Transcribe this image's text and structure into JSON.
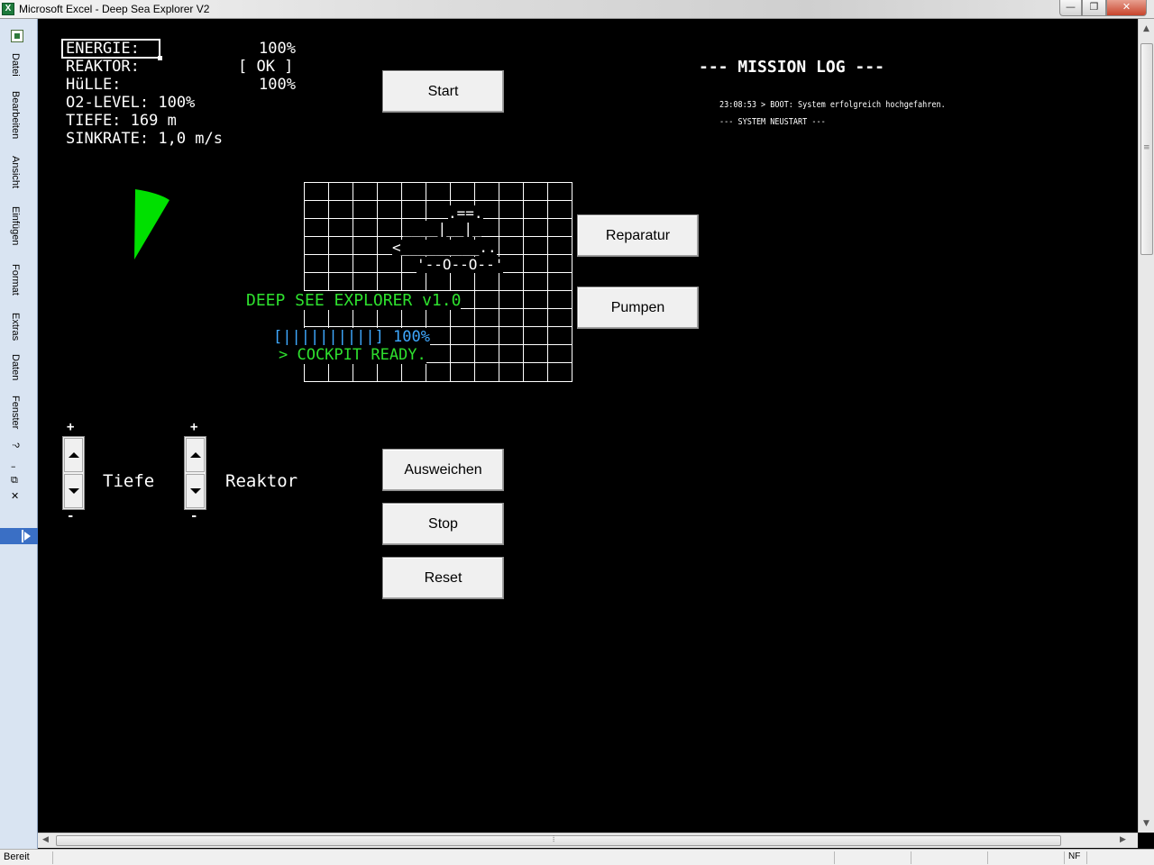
{
  "window": {
    "title": "Microsoft Excel - Deep Sea Explorer V2",
    "app_icon": "X",
    "minimize": "—",
    "maximize": "❐",
    "close": "✕"
  },
  "menu": {
    "items": [
      "Datei",
      "Bearbeiten",
      "Ansicht",
      "Einfügen",
      "Format",
      "Extras",
      "Daten",
      "Fenster",
      "?"
    ],
    "doc_min": "–",
    "doc_restore": "⧉",
    "doc_close": "✕"
  },
  "status": {
    "text": "Bereit",
    "nf": "NF"
  },
  "stats": {
    "energie_label": "ENERGIE:",
    "energie_value": "100%",
    "reaktor_label": "REAKTOR:",
    "reaktor_value": "[ OK ]",
    "huelle_label": "HüLLE:",
    "huelle_value": "100%",
    "o2": "O2-LEVEL: 100%",
    "tiefe": "TIEFE: 169 m",
    "sinkrate": "SINKRATE: 1,0 m/s"
  },
  "buttons": {
    "start": "Start",
    "reparatur": "Reparatur",
    "pumpen": "Pumpen",
    "ausweichen": "Ausweichen",
    "stop": "Stop",
    "reset": "Reset"
  },
  "log": {
    "title": "--- MISSION LOG ---",
    "lines": [
      "23:08:53 > BOOT: System erfolgreich hochgefahren.",
      "--- SYSTEM NEUSTART ---"
    ]
  },
  "ascii_sub": {
    "line1": ".==.",
    "line2": "____|__|_",
    "line3": "<_________..",
    "line4": "'--O--O--'"
  },
  "screen": {
    "title": "DEEP SEE EXPLORER v1.0",
    "progress": "[||||||||||] 100%",
    "ready": "> COCKPIT READY."
  },
  "controls": {
    "plus": "+",
    "minus": "-",
    "tiefe_label": "Tiefe",
    "reaktor_label": "Reaktor"
  },
  "colors": {
    "background": "#000000",
    "terminal_green": "#2ee02e",
    "progress_blue": "#3fa9ff",
    "radar_green": "#00e000"
  }
}
